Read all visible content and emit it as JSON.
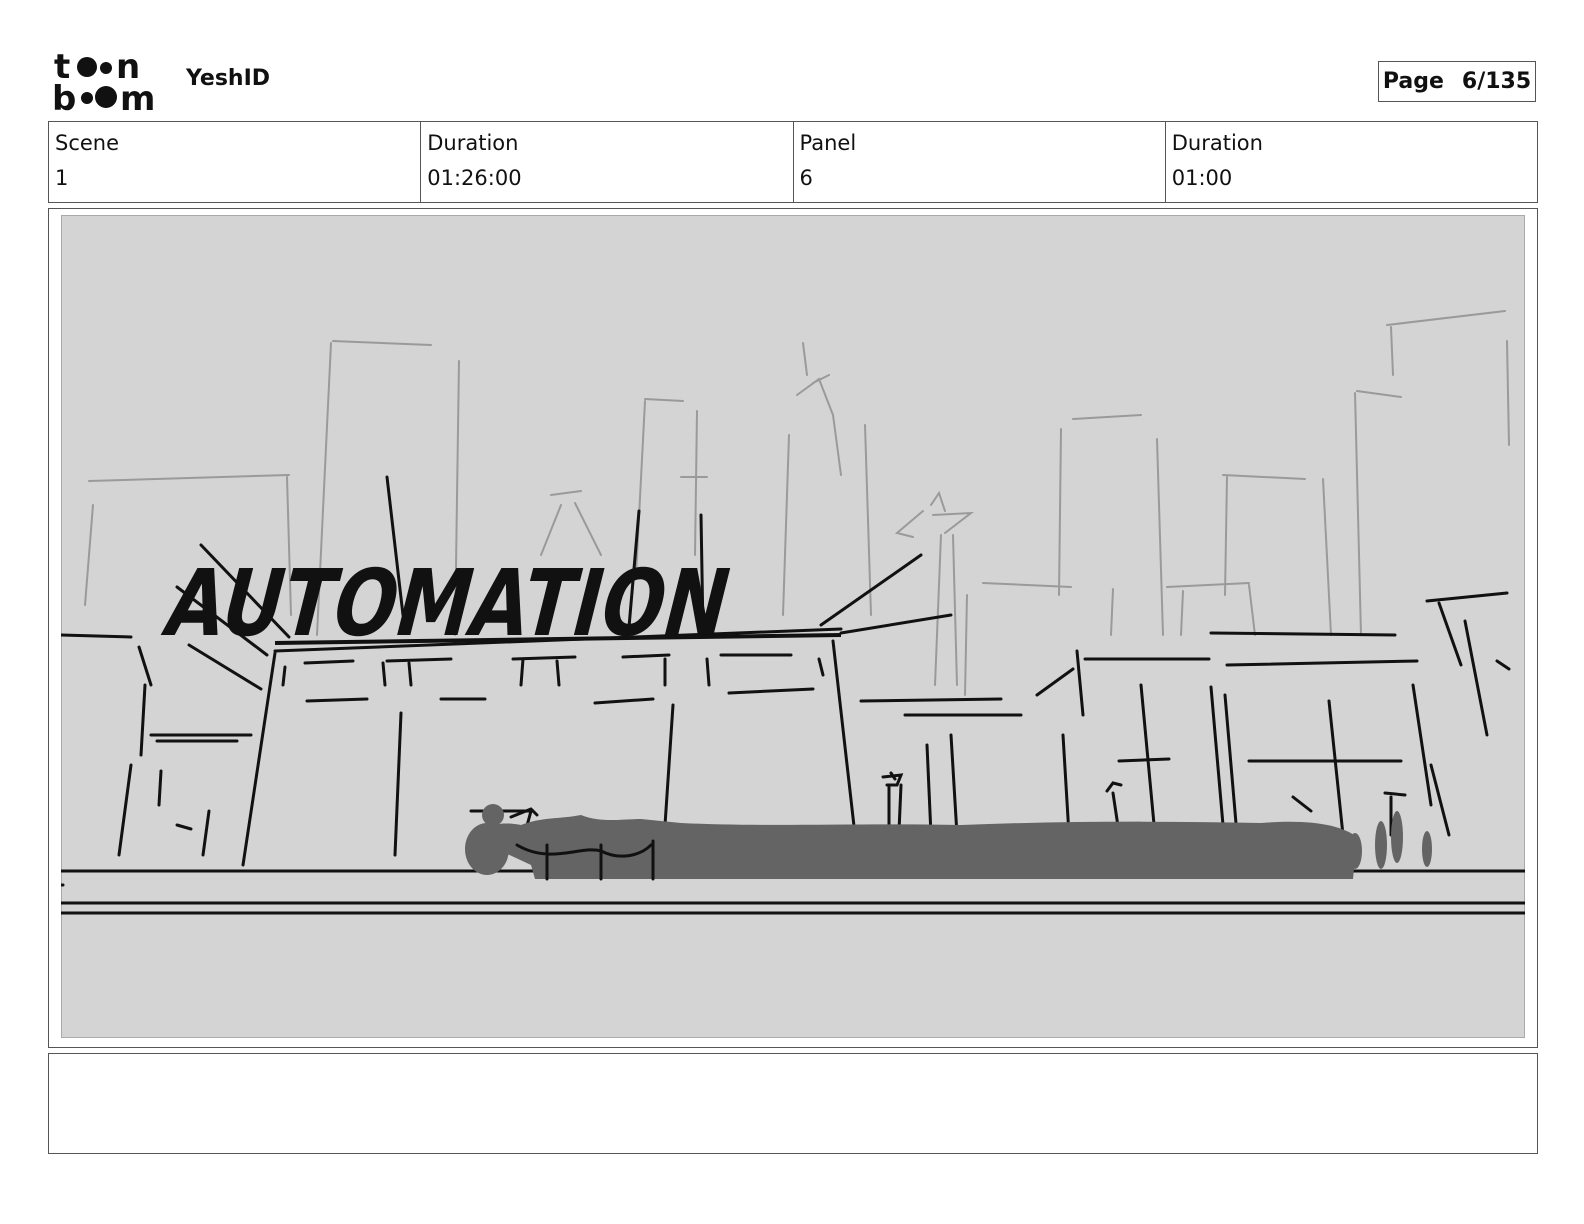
{
  "header": {
    "logo_text": "toon boom",
    "project_name": "YeshID",
    "page_label": "Page",
    "page_value": "6/135"
  },
  "info": {
    "scene_label": "Scene",
    "scene_value": "1",
    "duration_label": "Duration",
    "duration_value": "01:26:00",
    "panel_label": "Panel",
    "panel_value": "6",
    "panel_duration_label": "Duration",
    "panel_duration_value": "01:00"
  },
  "panel": {
    "sign_text": "AUTOMATION"
  },
  "notes": {
    "text": ""
  }
}
